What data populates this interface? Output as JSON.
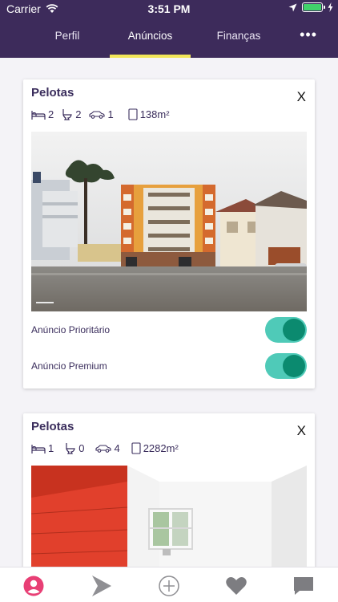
{
  "status_bar": {
    "carrier": "Carrier",
    "time": "3:51 PM"
  },
  "tabs": [
    {
      "label": "Perfil"
    },
    {
      "label": "Anúncios"
    },
    {
      "label": "Finanças"
    }
  ],
  "active_tab": "Anúncios",
  "colors": {
    "header": "#3d2b5b",
    "tab_indicator": "#f2e55a",
    "toggle_on": "#4fcab8",
    "toggle_knob": "#0b8a6f",
    "profile_icon": "#e83f75"
  },
  "listings": [
    {
      "city": "Pelotas",
      "close_label": "X",
      "bedrooms": "2",
      "bathrooms": "2",
      "parking": "1",
      "area": "138m²",
      "photo_icon": "apartment-building-photo",
      "toggles": [
        {
          "label": "Anúncio Prioritário",
          "on": true
        },
        {
          "label": "Anúncio Premium",
          "on": true
        }
      ]
    },
    {
      "city": "Pelotas",
      "close_label": "X",
      "bedrooms": "1",
      "bathrooms": "0",
      "parking": "4",
      "area": "2282m²",
      "photo_icon": "interior-room-photo"
    }
  ],
  "bottom_nav": [
    {
      "icon": "profile-icon",
      "active": true
    },
    {
      "icon": "arrow-icon"
    },
    {
      "icon": "add-circle-icon"
    },
    {
      "icon": "heart-icon"
    },
    {
      "icon": "chat-icon"
    }
  ]
}
